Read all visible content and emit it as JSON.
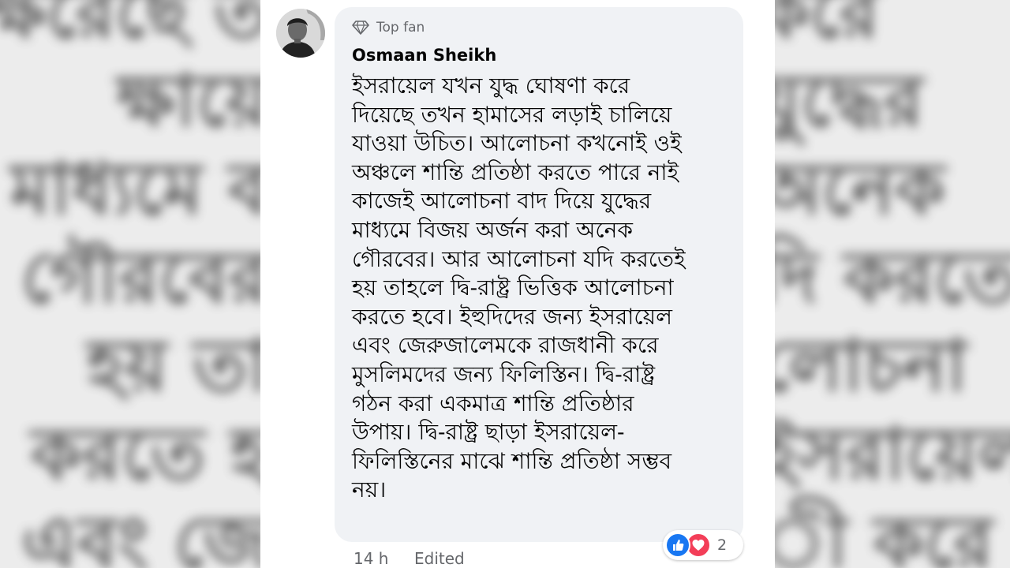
{
  "comment": {
    "badge_label": "Top fan",
    "author": "Osmaan Sheikh",
    "text": "ইসরায়েল যখন যুদ্ধ ঘোষণা করে\nদিয়েছে তখন হামাসের লড়াই চালিয়ে\nযাওয়া উচিত। আলোচনা কখনোই ওই\nঅঞ্চলে শান্তি প্রতিষ্ঠা করতে পারে নাই\nকাজেই আলোচনা বাদ দিয়ে যুদ্ধের\nমাধ্যমে বিজয় অর্জন করা অনেক\nগৌরবের। আর আলোচনা যদি করতেই\nহয় তাহলে দ্বি-রাষ্ট্র ভিত্তিক আলোচনা\nকরতে হবে। ইহুদিদের জন্য ইসরায়েল\nএবং জেরুজালেমকে রাজধানী করে\nমুসলিমদের জন্য ফিলিস্তিন। দ্বি-রাষ্ট্র\nগঠন করা একমাত্র শান্তি প্রতিষ্ঠার\nউপায়। দ্বি-রাষ্ট্র ছাড়া ইসরায়েল-\nফিলিস্তিনের মাঝে শান্তি প্রতিষ্ঠা সম্ভব\nনয়।",
    "reaction_count": "2",
    "reaction_icons": [
      "like-icon",
      "love-icon"
    ],
    "time": "14 h",
    "edited": "Edited"
  },
  "colors": {
    "bubble": "#f0f2f5",
    "like": "#1877f2",
    "love": "#f33e58",
    "secondary_text": "#65676b"
  }
}
